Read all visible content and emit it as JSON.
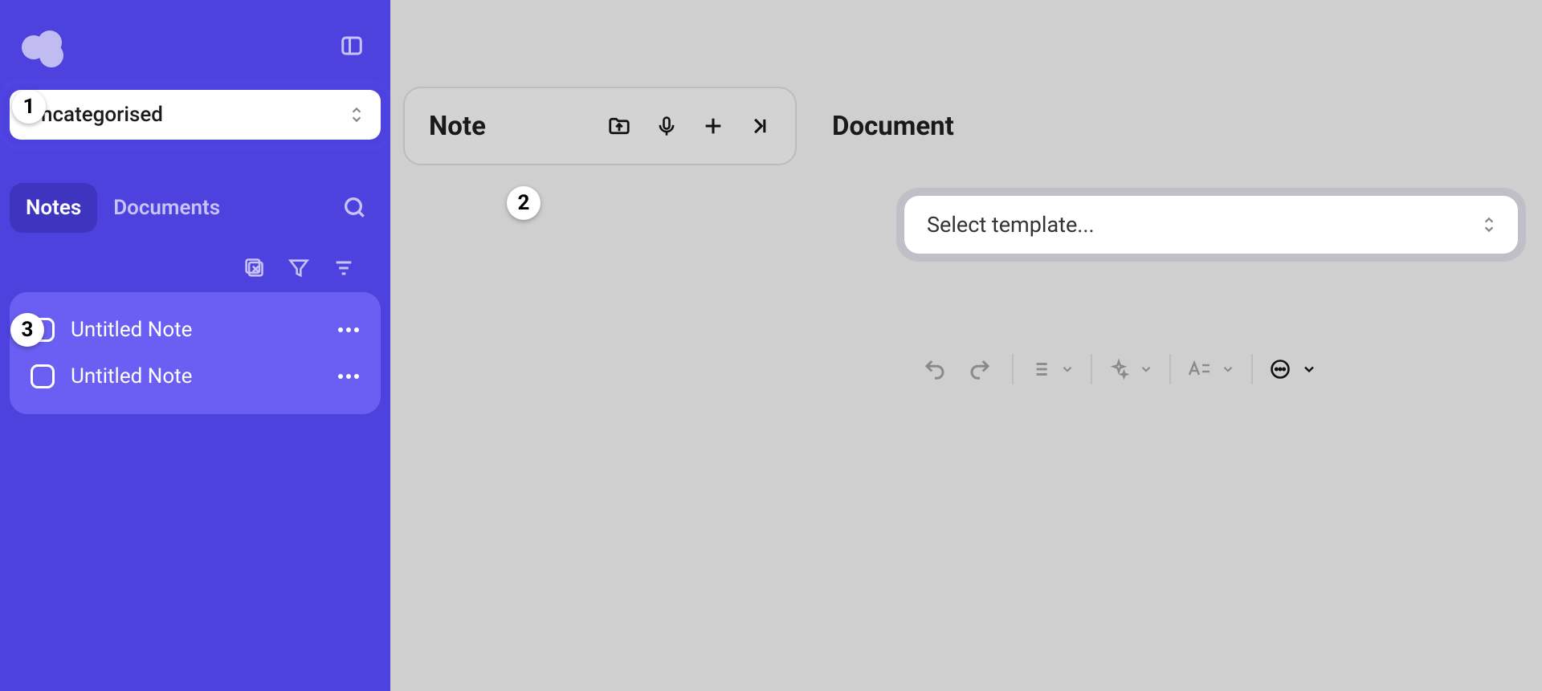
{
  "sidebar": {
    "category_selected": "Uncategorised",
    "tabs": {
      "notes": "Notes",
      "documents": "Documents"
    },
    "notes": [
      {
        "title": "Untitled Note"
      },
      {
        "title": "Untitled Note"
      }
    ]
  },
  "main": {
    "note_title": "Note",
    "document_title": "Document",
    "template_placeholder": "Select template..."
  },
  "callouts": {
    "one": "1",
    "two": "2",
    "three": "3"
  },
  "colors": {
    "sidebar": "#4e42de",
    "sidebar_light": "#6a5ff2"
  }
}
